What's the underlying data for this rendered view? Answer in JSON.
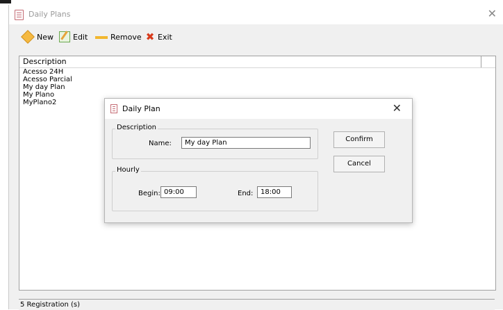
{
  "window": {
    "title": "Daily Plans",
    "close_glyph": "✕",
    "icon": "document-icon"
  },
  "toolbar": {
    "new_label": "New",
    "edit_label": "Edit",
    "remove_label": "Remove",
    "exit_label": "Exit",
    "icons": [
      "new-diamond-icon",
      "edit-icon",
      "remove-icon",
      "exit-x-icon"
    ]
  },
  "list": {
    "header": "Description",
    "items": [
      "Acesso 24H",
      "Acesso Parcial",
      "My day Plan",
      "My Plano",
      "MyPlano2"
    ]
  },
  "status": {
    "text": "5 Registration (s)"
  },
  "dialog": {
    "title": "Daily Plan",
    "close_glyph": "✕",
    "description_group": "Description",
    "name_label": "Name:",
    "name_value": "My day Plan",
    "hourly_group": "Hourly",
    "begin_label": "Begin:",
    "begin_value": "09:00",
    "end_label": "End:",
    "end_value": "18:00",
    "confirm_label": "Confirm",
    "cancel_label": "Cancel"
  },
  "colors": {
    "accent_exit": "#d83b1c",
    "remove_bar": "#f2b72e",
    "new_diamond": "#f5b941"
  }
}
